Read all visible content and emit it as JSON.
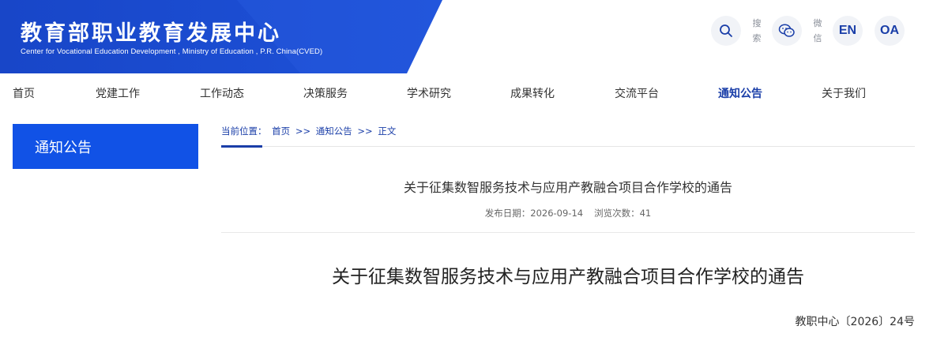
{
  "header": {
    "title": "教育部职业教育发展中心",
    "subtitle": "Center for Vocational Education Development , Ministry of Education , P.R. China(CVED)",
    "search_label": "搜索",
    "wechat_label": "微信",
    "en_label": "EN",
    "oa_label": "OA",
    "brand_color": "#1a3ea8"
  },
  "nav": {
    "items": [
      {
        "label": "首页"
      },
      {
        "label": "党建工作"
      },
      {
        "label": "工作动态"
      },
      {
        "label": "决策服务"
      },
      {
        "label": "学术研究"
      },
      {
        "label": "成果转化"
      },
      {
        "label": "交流平台"
      },
      {
        "label": "通知公告",
        "active": true
      },
      {
        "label": "关于我们"
      }
    ]
  },
  "sidebar": {
    "title": "通知公告"
  },
  "breadcrumb": {
    "prefix": "当前位置：",
    "home": "首页",
    "sep1": ">>",
    "section": "通知公告",
    "sep2": ">>",
    "current": "正文"
  },
  "article": {
    "title": "关于征集数智服务技术与应用产教融合项目合作学校的通告",
    "date_label": "发布日期：2026-09-14",
    "views_label": "浏览次数：41",
    "doc_title": "关于征集数智服务技术与应用产教融合项目合作学校的通告",
    "doc_number": "教职中心〔2026〕24号"
  }
}
